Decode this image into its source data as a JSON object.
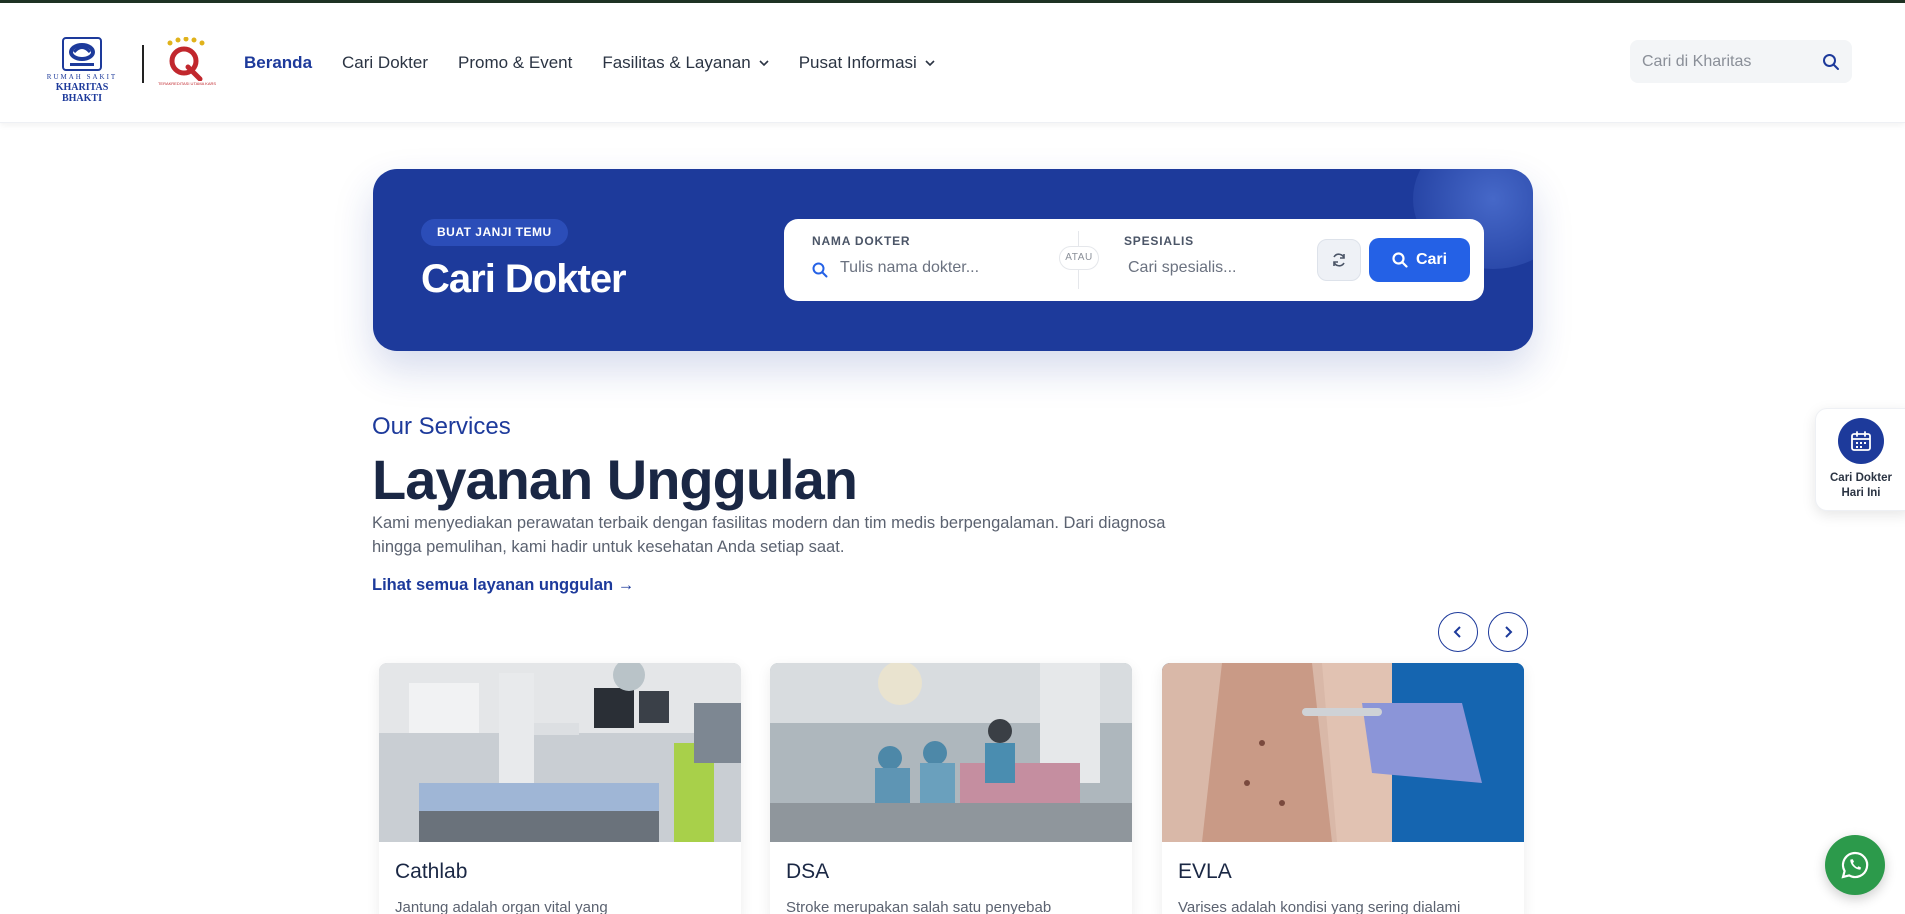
{
  "logo": {
    "small_text": "RUMAH SAKIT",
    "name": "KHARITAS BHAKTI",
    "accreditation_caption": "TERAKREDITASI UTAMA KARS"
  },
  "nav": {
    "items": [
      {
        "label": "Beranda",
        "active": true,
        "dropdown": false
      },
      {
        "label": "Cari Dokter",
        "active": false,
        "dropdown": false
      },
      {
        "label": "Promo & Event",
        "active": false,
        "dropdown": false
      },
      {
        "label": "Fasilitas & Layanan",
        "active": false,
        "dropdown": true
      },
      {
        "label": "Pusat Informasi",
        "active": false,
        "dropdown": true
      }
    ]
  },
  "search": {
    "placeholder": "Cari di Kharitas",
    "icon": "search-icon"
  },
  "hero": {
    "pill": "BUAT JANJI TEMU",
    "title": "Cari Dokter",
    "doctor_label": "NAMA DOKTER",
    "doctor_placeholder": "Tulis nama dokter...",
    "separator": "ATAU",
    "specialist_label": "SPESIALIS",
    "specialist_placeholder": "Cari spesialis...",
    "reset_icon": "refresh-icon",
    "search_button": "Cari"
  },
  "services": {
    "eyebrow": "Our Services",
    "title": "Layanan Unggulan",
    "description": "Kami menyediakan perawatan terbaik dengan fasilitas modern dan tim medis berpengalaman. Dari diagnosa hingga pemulihan, kami hadir untuk kesehatan Anda setiap saat.",
    "link": "Lihat semua layanan unggulan →",
    "cards": [
      {
        "title": "Cathlab",
        "text": "Jantung adalah organ vital yang"
      },
      {
        "title": "DSA",
        "text": "Stroke merupakan salah satu penyebab"
      },
      {
        "title": "EVLA",
        "text": "Varises adalah kondisi yang sering dialami"
      }
    ]
  },
  "floating": {
    "label_line1": "Cari Dokter",
    "label_line2": "Hari Ini",
    "icon": "calendar-icon"
  },
  "whatsapp": {
    "icon": "whatsapp-icon"
  },
  "colors": {
    "brand": "#1d3a9b",
    "button": "#2461e6",
    "whatsapp": "#2c9a4b"
  }
}
